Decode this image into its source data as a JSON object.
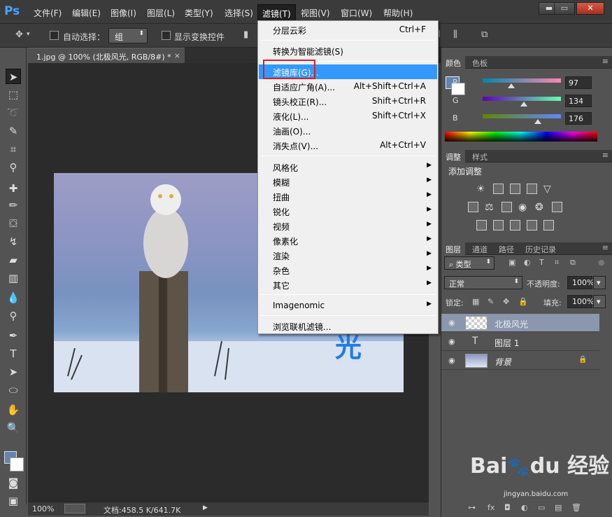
{
  "app": {
    "logo": "Ps"
  },
  "menubar": {
    "items": [
      "文件(F)",
      "编辑(E)",
      "图像(I)",
      "图层(L)",
      "类型(Y)",
      "选择(S)",
      "滤镜(T)",
      "视图(V)",
      "窗口(W)",
      "帮助(H)"
    ],
    "active": "滤镜(T)"
  },
  "window_controls": {
    "minimize": "▬",
    "restore": "▭",
    "close": "✕"
  },
  "options": {
    "auto_select_label": "自动选择：",
    "auto_select_value": "组",
    "show_transform_label": "显示变换控件"
  },
  "document": {
    "tab_title": "1.jpg @ 100% (北极风光, RGB/8#) *",
    "close": "×",
    "overlay_text": "光"
  },
  "status": {
    "zoom": "100%",
    "doc_info": "文档:458.5 K/641.7K"
  },
  "filter_menu": {
    "items": [
      {
        "label": "分层云彩",
        "shortcut": "Ctrl+F"
      },
      {
        "label": "转换为智能滤镜(S)",
        "shortcut": ""
      },
      {
        "label": "滤镜库(G)...",
        "shortcut": ""
      },
      {
        "label": "自适应广角(A)...",
        "shortcut": "Alt+Shift+Ctrl+A"
      },
      {
        "label": "镜头校正(R)...",
        "shortcut": "Shift+Ctrl+R"
      },
      {
        "label": "液化(L)...",
        "shortcut": "Shift+Ctrl+X"
      },
      {
        "label": "油画(O)...",
        "shortcut": ""
      },
      {
        "label": "消失点(V)...",
        "shortcut": "Alt+Ctrl+V"
      },
      {
        "label": "风格化",
        "shortcut": ""
      },
      {
        "label": "模糊",
        "shortcut": ""
      },
      {
        "label": "扭曲",
        "shortcut": ""
      },
      {
        "label": "锐化",
        "shortcut": ""
      },
      {
        "label": "视频",
        "shortcut": ""
      },
      {
        "label": "像素化",
        "shortcut": ""
      },
      {
        "label": "渲染",
        "shortcut": ""
      },
      {
        "label": "杂色",
        "shortcut": ""
      },
      {
        "label": "其它",
        "shortcut": ""
      },
      {
        "label": "Imagenomic",
        "shortcut": ""
      },
      {
        "label": "浏览联机滤镜...",
        "shortcut": ""
      }
    ],
    "highlighted": "滤镜库(G)..."
  },
  "color_panel": {
    "tabs": [
      "颜色",
      "色板"
    ],
    "r_label": "R",
    "g_label": "G",
    "b_label": "B",
    "r": "97",
    "g": "134",
    "b": "176",
    "foreground": "#6185b0",
    "background": "#ffffff"
  },
  "adjust_panel": {
    "tabs": [
      "调整",
      "样式"
    ],
    "title": "添加调整"
  },
  "layers_panel": {
    "tabs": [
      "图层",
      "通道",
      "路径",
      "历史记录"
    ],
    "filter_label": "类型",
    "blend_mode": "正常",
    "opacity_label": "不透明度:",
    "opacity": "100%",
    "lock_label": "锁定:",
    "fill_label": "填充:",
    "fill": "100%",
    "layers": [
      {
        "name": "北极风光",
        "type": "smart",
        "selected": true
      },
      {
        "name": "图层 1",
        "type": "text",
        "selected": false
      },
      {
        "name": "背景",
        "type": "background",
        "selected": false
      }
    ]
  },
  "watermark": {
    "brand": "Bai",
    "paw": "du",
    "suffix": "经验",
    "url": "jingyan.baidu.com"
  },
  "icons": {
    "eye": "eye-icon",
    "lock": "lock-icon",
    "submenu": "chevron-right-icon"
  }
}
